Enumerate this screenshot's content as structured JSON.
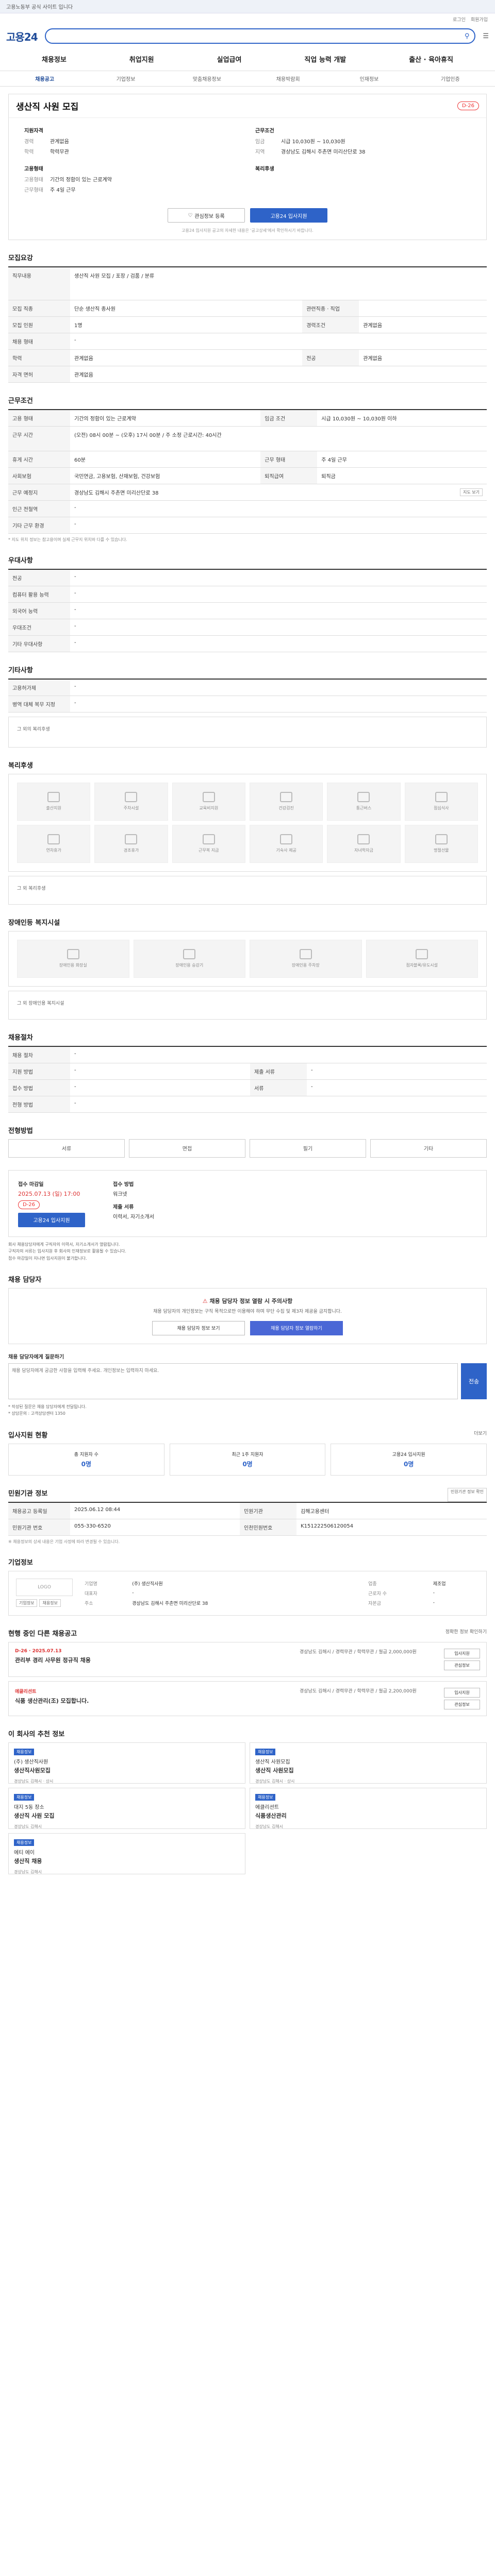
{
  "banner": "고용노동부 공식 사이트 입니다",
  "util": {
    "login": "로그인",
    "join": "회원가입"
  },
  "header": {
    "logo": "고용24"
  },
  "gnb": [
    "채용정보",
    "취업지원",
    "실업급여",
    "직업 능력 개발",
    "출산 · 육아휴직"
  ],
  "subnav": [
    "채용공고",
    "기업정보",
    "맞춤채용정보",
    "채용박람회",
    "인재정보",
    "기업인증"
  ],
  "job": {
    "title": "생산직 사원 모집",
    "dday": "D-26",
    "qual_label": "지원자격",
    "career_k": "경력",
    "career_v": "관계없음",
    "edu_k": "학력",
    "edu_v": "학력무관",
    "cond_label": "근무조건",
    "pay_k": "임금",
    "pay_v": "시급 10,030원 ~ 10,030원",
    "region_k": "지역",
    "region_v": "경상남도 김해시 주촌면 미리산단로 38",
    "type_label": "고용형태",
    "emp_k": "고용형태",
    "emp_v": "기간의 정함이 있는 근로계약",
    "hours_k": "근무형태",
    "hours_v": "주 4일 근무",
    "welfare_label": "복리후생",
    "btn_save": "관심정보 등록",
    "btn_apply": "고용24 입사지원",
    "notice": "고용24 입사지원 공고의 자세한 내용은 '공고상세'에서 확인하시기 바랍니다."
  },
  "recruit": {
    "title": "모집요강",
    "duty_k": "직무내용",
    "duty_v": "생산직 사원 모집 / 포장 / 검품 / 분류",
    "rows": [
      {
        "k": "모집 직종",
        "v": "단순 생산직 종사원",
        "k2": "관련직종 · 직업",
        "v2": ""
      },
      {
        "k": "모집 인원",
        "v": "1명",
        "k2": "경력조건",
        "v2": "관계없음"
      },
      {
        "k": "채용 형태",
        "v": "-",
        "k2": "",
        "v2": ""
      },
      {
        "k": "학력",
        "v": "관계없음",
        "k2": "전공",
        "v2": "관계없음"
      },
      {
        "k": "자격 면허",
        "v": "관계없음",
        "k2": "",
        "v2": ""
      }
    ]
  },
  "work": {
    "title": "근무조건",
    "rows": [
      {
        "k": "고용 형태",
        "v": "기간의 정함이 있는 근로계약",
        "k2": "임금 조건",
        "v2": "시급 10,030원 ~ 10,030원 이하"
      },
      {
        "k": "근무 시간",
        "v": "(오전) 08시 00분 ~ (오후) 17시 00분 / 주 소정 근로시간: 40시간",
        "k2": "",
        "v2": ""
      },
      {
        "k": "휴게 시간",
        "v": "60분",
        "k2": "근무 형태",
        "v2": "주 4일 근무"
      },
      {
        "k": "사회보험",
        "v": "국민연금, 고용보험, 산재보험, 건강보험",
        "k2": "퇴직급여",
        "v2": "퇴직금"
      },
      {
        "k": "근무 예정지",
        "v": "경상남도 김해시 주촌면 미리산단로 38",
        "k2": "",
        "v2": ""
      },
      {
        "k": "인근 전철역",
        "v": "-",
        "k2": "",
        "v2": ""
      },
      {
        "k": "기타 근무 환경",
        "v": "-",
        "k2": "",
        "v2": ""
      }
    ],
    "map_btn": "지도 보기",
    "note": "* 지도 위치 정보는 참고용이며 실제 근무지 위치와 다를 수 있습니다."
  },
  "perks": {
    "title": "우대사항",
    "rows": [
      {
        "k": "전공",
        "v": "-"
      },
      {
        "k": "컴퓨터 활용 능력",
        "v": "-"
      },
      {
        "k": "외국어 능력",
        "v": "-"
      },
      {
        "k": "우대조건",
        "v": "-"
      },
      {
        "k": "기타 우대사항",
        "v": "-"
      }
    ]
  },
  "other": {
    "title": "기타사항",
    "rows": [
      {
        "k": "고용허가제",
        "v": "-"
      },
      {
        "k": "병역 대체 복무 지정",
        "v": "-"
      }
    ],
    "extra_label": "그 외의 복리후생"
  },
  "welfare": {
    "title": "복리후생",
    "items": [
      "출산지원",
      "주차시설",
      "교육비지원",
      "건강검진",
      "통근버스",
      "점심식사",
      "연차휴가",
      "경조휴가",
      "근무복 지급",
      "기숙사 제공",
      "자녀학자금",
      "명절선물"
    ],
    "extra": "그 외 복리후생"
  },
  "disabled": {
    "title": "장애인등 복지시설",
    "items": [
      "장애인용 화장실",
      "장애인용 승강기",
      "장애인용 주차장",
      "점자블록/유도시설"
    ],
    "extra": "그 외 장애인용 복지시설"
  },
  "recruit_process": {
    "title": "채용절차",
    "rows": [
      {
        "k": "채용 절차",
        "v": "-",
        "k2": "",
        "v2": ""
      },
      {
        "k": "지원 방법",
        "v": "-",
        "k2": "제출 서류",
        "v2": "-"
      },
      {
        "k": "접수 방법",
        "v": "-",
        "k2": "서류",
        "v2": "-"
      },
      {
        "k": "전형 방법",
        "v": "-",
        "k2": "",
        "v2": ""
      }
    ]
  },
  "method": {
    "title": "전형방법",
    "chips": [
      "서류",
      "면접",
      "필기",
      "기타"
    ]
  },
  "process": {
    "t1": "접수 마감일",
    "v1": "2025.07.13 (일) 17:00",
    "dday": "D-26",
    "t2": "접수 방법",
    "v2": "워크넷",
    "t3": "제출 서류",
    "v3": "이력서, 자기소개서",
    "apply": "고용24 입사지원",
    "bullets": [
      "회사 채용담당자에게 구직자의 이력서, 자기소개서가 열람됩니다.",
      "구직자의 서류는 입사지원 후 회사의 인재정보로 활용될 수 있습니다.",
      "접수 마감일이 지나면 입사지원이 불가합니다."
    ]
  },
  "manager": {
    "title": "채용 담당자",
    "warn": "채용 담당자 정보 열람 시 주의사항",
    "desc": "채용 담당자의 개인정보는 구직 목적으로만 이용해야 하며 무단 수집 및 제3자 제공을 금지합니다.",
    "btn1": "채용 담당자 정보 보기",
    "btn2": "채용 담당자 정보 열람하기",
    "qa_title": "채용 담당자에게 질문하기",
    "qa_placeholder": "채용 담당자에게 궁금한 사항을 입력해 주세요. 개인정보는 입력하지 마세요.",
    "qa_submit": "전송",
    "qa_note1": "* 작성된 질문은 채용 담당자에게 전달됩니다.",
    "qa_note2": "* 상담문의 : 고객상담센터 1350"
  },
  "status": {
    "title": "입사지원 현황",
    "more": "더보기",
    "items": [
      {
        "label": "총 지원자 수",
        "value": "0명"
      },
      {
        "label": "최근 1주 지원자",
        "value": "0명"
      },
      {
        "label": "고용24 입사지원",
        "value": "0명"
      }
    ]
  },
  "gov": {
    "title": "민원기관 정보",
    "btn": "민원기관 정보 확인",
    "rows": [
      {
        "k": "채용공고 등록일",
        "v": "2025.06.12 08:44",
        "k2": "민원기관",
        "v2": "김해고용센터"
      },
      {
        "k": "민원기관 번호",
        "v": "055-330-6520",
        "k2": "인천민원번호",
        "v2": "K151222506120054"
      }
    ],
    "note": "※ 채용정보의 상세 내용은 기업 사정에 따라 변경될 수 있습니다."
  },
  "company": {
    "title": "기업정보",
    "logo": "LOGO",
    "name": "(주) 생산직사원",
    "rows": [
      {
        "k": "기업명",
        "v": "(주) 생산직사원",
        "k2": "업종",
        "v2": "제조업"
      },
      {
        "k": "대표자",
        "v": "-",
        "k2": "근로자 수",
        "v2": "-"
      },
      {
        "k": "주소",
        "v": "경상남도 김해시 주촌면 미리산단로 38",
        "k2": "자본금",
        "v2": "-"
      }
    ],
    "btn1": "기업정보",
    "btn2": "채용정보"
  },
  "related": {
    "title": "현행 중인 다른 채용공고",
    "more": "정확한 정보 확인하기",
    "items": [
      {
        "date": "D-26 · 2025.07.13",
        "title": "관리부 경리 사무원 정규직 채용",
        "info": "경상남도 김해시 / 경력무관 / 학력무관 / 월급 2,000,000원",
        "b1": "입사지원",
        "b2": "관심정보"
      },
      {
        "company": "에클리션트",
        "title": "식품 생산관리(조) 모집합니다.",
        "info": "경상남도 김해시 / 경력무관 / 학력무관 / 월급 2,200,000원",
        "b1": "입사지원",
        "b2": "관심정보"
      }
    ]
  },
  "recommend": {
    "title": "이 회사의 추천 정보",
    "items": [
      {
        "tag": "채용정보",
        "name": "(주) 생산직사원",
        "title": "생산직사원모집",
        "meta": "경상남도 김해시 · 상시"
      },
      {
        "tag": "채용정보",
        "name": "생산직 사원모집",
        "title": "생산직 사원모집",
        "meta": "경상남도 김해시 · 상시"
      },
      {
        "tag": "채용정보",
        "name": "대지 5동 장소",
        "title": "생산직 사원 모집",
        "meta": "경상남도 김해시"
      },
      {
        "tag": "채용정보",
        "name": "에클리션트",
        "title": "식품생산관리",
        "meta": "경상남도 김해시"
      },
      {
        "tag": "채용정보",
        "name": "에티 에이",
        "title": "생산직 채용",
        "meta": "경상남도 김해시"
      }
    ]
  },
  "colors": {
    "accent": "#2e63c8",
    "warn": "#dd3333"
  }
}
